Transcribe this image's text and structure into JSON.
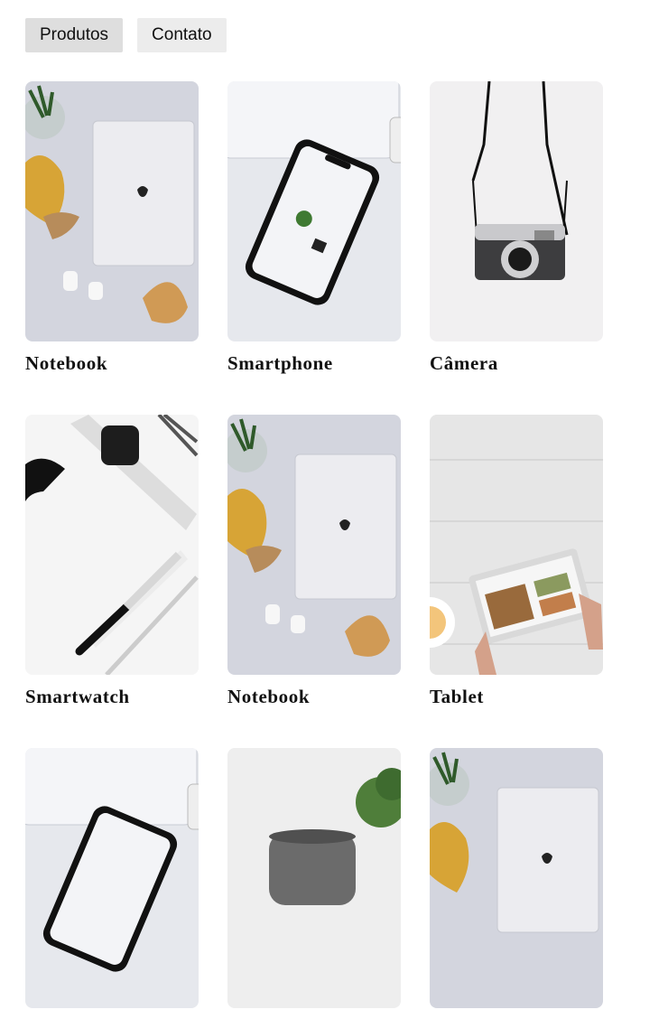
{
  "nav": {
    "items": [
      {
        "label": "Produtos"
      },
      {
        "label": "Contato"
      }
    ]
  },
  "products": [
    {
      "name": "Notebook",
      "image": "notebook-photo"
    },
    {
      "name": "Smartphone",
      "image": "smartphone-photo"
    },
    {
      "name": "Câmera",
      "image": "camera-photo"
    },
    {
      "name": "Smartwatch",
      "image": "smartwatch-photo"
    },
    {
      "name": "Notebook",
      "image": "notebook-photo"
    },
    {
      "name": "Tablet",
      "image": "tablet-photo"
    },
    {
      "name": "",
      "image": "smartphone-photo"
    },
    {
      "name": "",
      "image": "smart-speaker-photo"
    },
    {
      "name": "",
      "image": "notebook-photo"
    }
  ]
}
